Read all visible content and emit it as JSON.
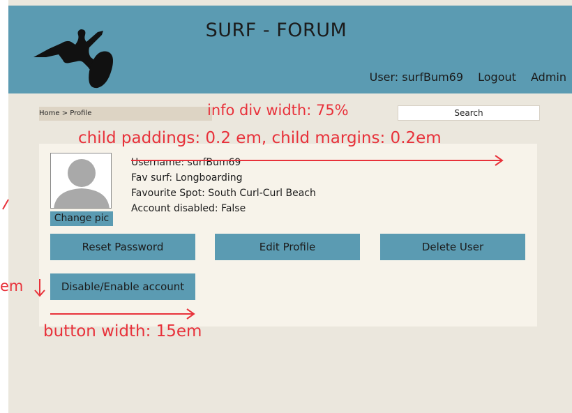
{
  "header": {
    "title": "SURF - FORUM",
    "nav": {
      "user_label": "User: surfBum69",
      "logout": "Logout",
      "admin": "Admin"
    }
  },
  "breadcrumb": "Home > Profile",
  "search": {
    "label": "Search"
  },
  "profile": {
    "username": "Username: surfBum69",
    "fav_surf": "Fav surf: Longboarding",
    "favourite_spot": "Favourite Spot: South Curl-Curl Beach",
    "account_disabled": "Account disabled: False",
    "change_pic": "Change pic"
  },
  "buttons": {
    "reset_password": "Reset Password",
    "edit_profile": "Edit Profile",
    "delete_user": "Delete User",
    "disable_enable": "Disable/Enable account"
  },
  "annotations": {
    "info_div_width": "info div width: 75%",
    "child_spacing": "child paddings: 0.2 em, child margins: 0.2em",
    "button_width": "button width: 15em",
    "em_fragment": "em"
  },
  "colors": {
    "header_bg": "#5b9bb2",
    "button_bg": "#5b9bb2",
    "annotation": "#e8313a",
    "panel_bg": "#f7f3ea",
    "page_bg": "#ebe7dd"
  }
}
